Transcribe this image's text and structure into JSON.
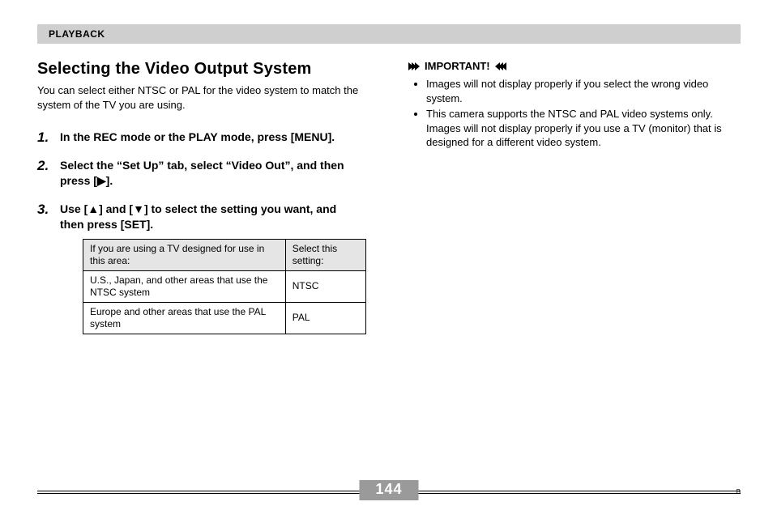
{
  "header": {
    "section": "PLAYBACK"
  },
  "left": {
    "title": "Selecting the Video Output System",
    "intro": "You can select either NTSC or PAL for the video system to match the system of the TV you are using.",
    "steps": [
      {
        "n": "1.",
        "text": "In the REC mode or the PLAY mode, press [MENU]."
      },
      {
        "n": "2.",
        "text": "Select the “Set Up” tab, select “Video Out”, and then press [▶]."
      },
      {
        "n": "3.",
        "text": "Use [▲] and [▼] to select the setting you want, and then press [SET]."
      }
    ],
    "table": {
      "head": [
        "If you are using a TV designed for use in this area:",
        "Select this setting:"
      ],
      "rows": [
        [
          "U.S., Japan, and other areas that use the NTSC system",
          "NTSC"
        ],
        [
          "Europe and other areas that use the PAL system",
          "PAL"
        ]
      ]
    }
  },
  "right": {
    "important_label": "IMPORTANT!",
    "bullets": [
      "Images will not display properly if you select the wrong video system.",
      "This camera supports the NTSC and PAL video systems only. Images will not display properly if you use a TV (monitor) that is designed for a different video system."
    ]
  },
  "footer": {
    "page": "144",
    "mark": "B"
  }
}
